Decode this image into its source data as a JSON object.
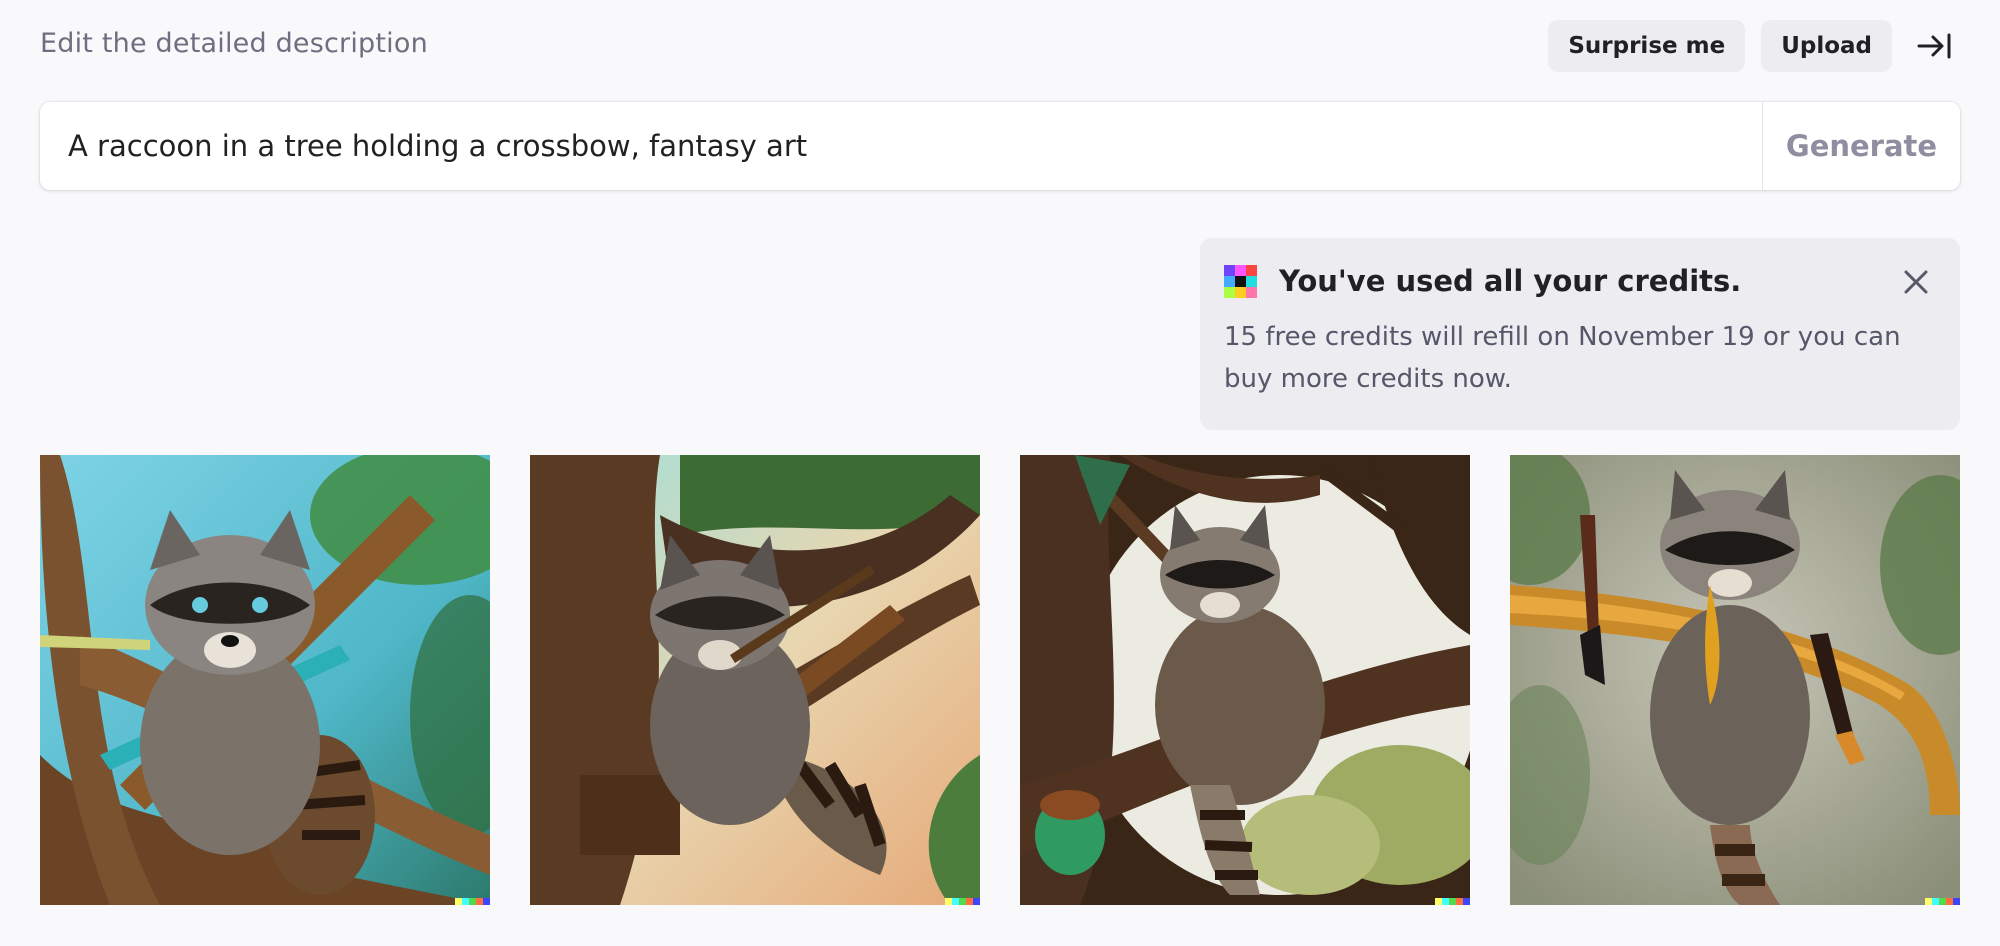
{
  "header": {
    "heading": "Edit the detailed description",
    "surprise_label": "Surprise me",
    "upload_label": "Upload",
    "collapse_icon": "arrow-right-to-bar-icon"
  },
  "prompt": {
    "value": "A raccoon in a tree holding a crossbow, fantasy art",
    "generate_label": "Generate"
  },
  "notice": {
    "title": "You've used all your credits.",
    "body": "15 free credits will refill on November 19 or you can buy more credits now.",
    "logo_colors": [
      "#6e44ff",
      "#ff55ff",
      "#ff4444",
      "#44aaff",
      "#111111",
      "#22dddd",
      "#aaff44",
      "#ffcc22",
      "#ff77aa"
    ],
    "close_icon": "close-x-icon"
  },
  "images": [
    {
      "icon": "raccoon-image",
      "alt": "raccoon on branch with crossbow, blue sky"
    },
    {
      "icon": "raccoon-image",
      "alt": "raccoon in tree with spear, sunrays"
    },
    {
      "icon": "raccoon-image",
      "alt": "raccoon climbing tree with crossbow"
    },
    {
      "icon": "raccoon-image",
      "alt": "raccoon on orange branch, foggy forest"
    }
  ],
  "signature_colors": [
    "#ffff66",
    "#42ffff",
    "#51da4c",
    "#ff6e3c",
    "#3c46ff"
  ]
}
